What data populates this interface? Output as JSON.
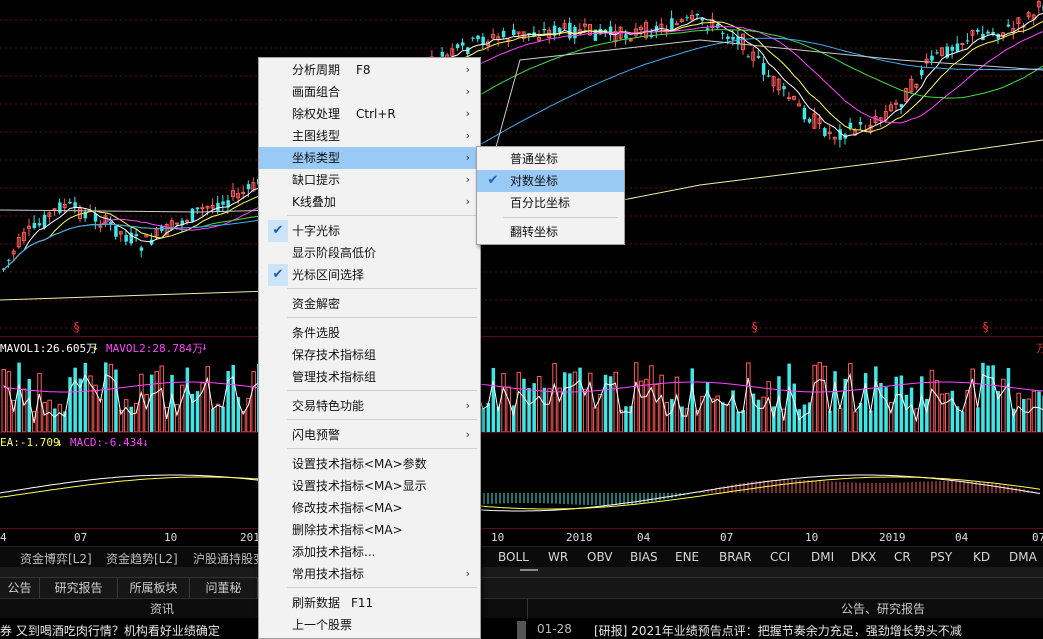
{
  "price_chart": {
    "gap_markers": [
      "§",
      "§",
      "§"
    ],
    "colors": {
      "up": "#ff5a5a",
      "down": "#3ee6e6",
      "ma_white": "#ffffff",
      "ma_yellow": "#ffff55",
      "ma_magenta": "#ff44ff",
      "ma_green": "#44dd44",
      "ma_blue": "#44aaee",
      "ma_long": "#eeeeaa",
      "grid": "#661111"
    }
  },
  "volume_panel": {
    "labels": [
      {
        "text": "MAVOL1:26.605万",
        "color": "#ffffff"
      },
      {
        "text": "↓",
        "color": "#ffff55"
      },
      {
        "text": "MAVOL2:28.784万",
        "color": "#ff44ff"
      },
      {
        "text": "↓",
        "color": "#ff44ff"
      }
    ],
    "right_edge_text": "万"
  },
  "macd_panel": {
    "labels": [
      {
        "text": "EA:-1.709",
        "color": "#ffff55"
      },
      {
        "text": "↓",
        "color": "#ffff55"
      },
      {
        "text": "MACD:-6.434",
        "color": "#ff44ff"
      },
      {
        "text": "↓",
        "color": "#ff44ff"
      }
    ]
  },
  "time_axis": {
    "labels": [
      "4",
      "07",
      "10",
      "201",
      "10",
      "2018",
      "04",
      "07",
      "10",
      "2019",
      "04",
      "07"
    ]
  },
  "indicator_tabs": {
    "left": [
      "资金博弈[L2]",
      "资金趋势[L2]",
      "沪股通持股变"
    ],
    "tabs": [
      "BOLL",
      "WR",
      "OBV",
      "BIAS",
      "ENE",
      "BRAR",
      "CCI",
      "DMI",
      "DKX",
      "CR",
      "PSY",
      "KD",
      "DMA"
    ]
  },
  "bottom_tabs": [
    "公告",
    "研究报告",
    "所属板块",
    "问董秘"
  ],
  "panels": {
    "left": "资讯",
    "right": "公告、研究报告"
  },
  "news": {
    "left": "券 又到喝酒吃肉行情？机构看好业绩确定",
    "right_date": "01-28",
    "right_text": "[研报] 2021年业绩预告点评：把握节奏余力充足，强劲增长势头不减"
  },
  "context_menu": {
    "items": [
      {
        "label": "分析周期",
        "shortcut": "F8",
        "submenu": true
      },
      {
        "label": "画面组合",
        "submenu": true
      },
      {
        "label": "除权处理",
        "shortcut": "Ctrl+R",
        "submenu": true
      },
      {
        "label": "主图线型",
        "submenu": true
      },
      {
        "label": "坐标类型",
        "submenu": true,
        "highlighted": true
      },
      {
        "label": "缺口提示",
        "submenu": true
      },
      {
        "label": "K线叠加",
        "submenu": true
      },
      {
        "separator": true
      },
      {
        "label": "十字光标",
        "checked": true
      },
      {
        "label": "显示阶段高低价"
      },
      {
        "label": "光标区间选择",
        "checked": true
      },
      {
        "separator": true
      },
      {
        "label": "资金解密"
      },
      {
        "separator": true
      },
      {
        "label": "条件选股"
      },
      {
        "label": "保存技术指标组"
      },
      {
        "label": "管理技术指标组"
      },
      {
        "separator": true
      },
      {
        "label": "交易特色功能",
        "submenu": true
      },
      {
        "separator": true
      },
      {
        "label": "闪电预警",
        "submenu": true
      },
      {
        "separator": true
      },
      {
        "label": "设置技术指标<MA>参数"
      },
      {
        "label": "设置技术指标<MA>显示"
      },
      {
        "label": "修改技术指标<MA>"
      },
      {
        "label": "删除技术指标<MA>"
      },
      {
        "label": "添加技术指标..."
      },
      {
        "label": "常用技术指标",
        "submenu": true
      },
      {
        "separator": true
      },
      {
        "label": "刷新数据",
        "shortcut": "F11"
      },
      {
        "label": "上一个股票"
      }
    ],
    "arrow_glyph": "›",
    "check_glyph": "✔"
  },
  "submenu": {
    "items": [
      {
        "label": "普通坐标"
      },
      {
        "label": "对数坐标",
        "checked": true,
        "highlighted": true
      },
      {
        "label": "百分比坐标"
      },
      {
        "separator": true
      },
      {
        "label": "翻转坐标"
      }
    ]
  }
}
